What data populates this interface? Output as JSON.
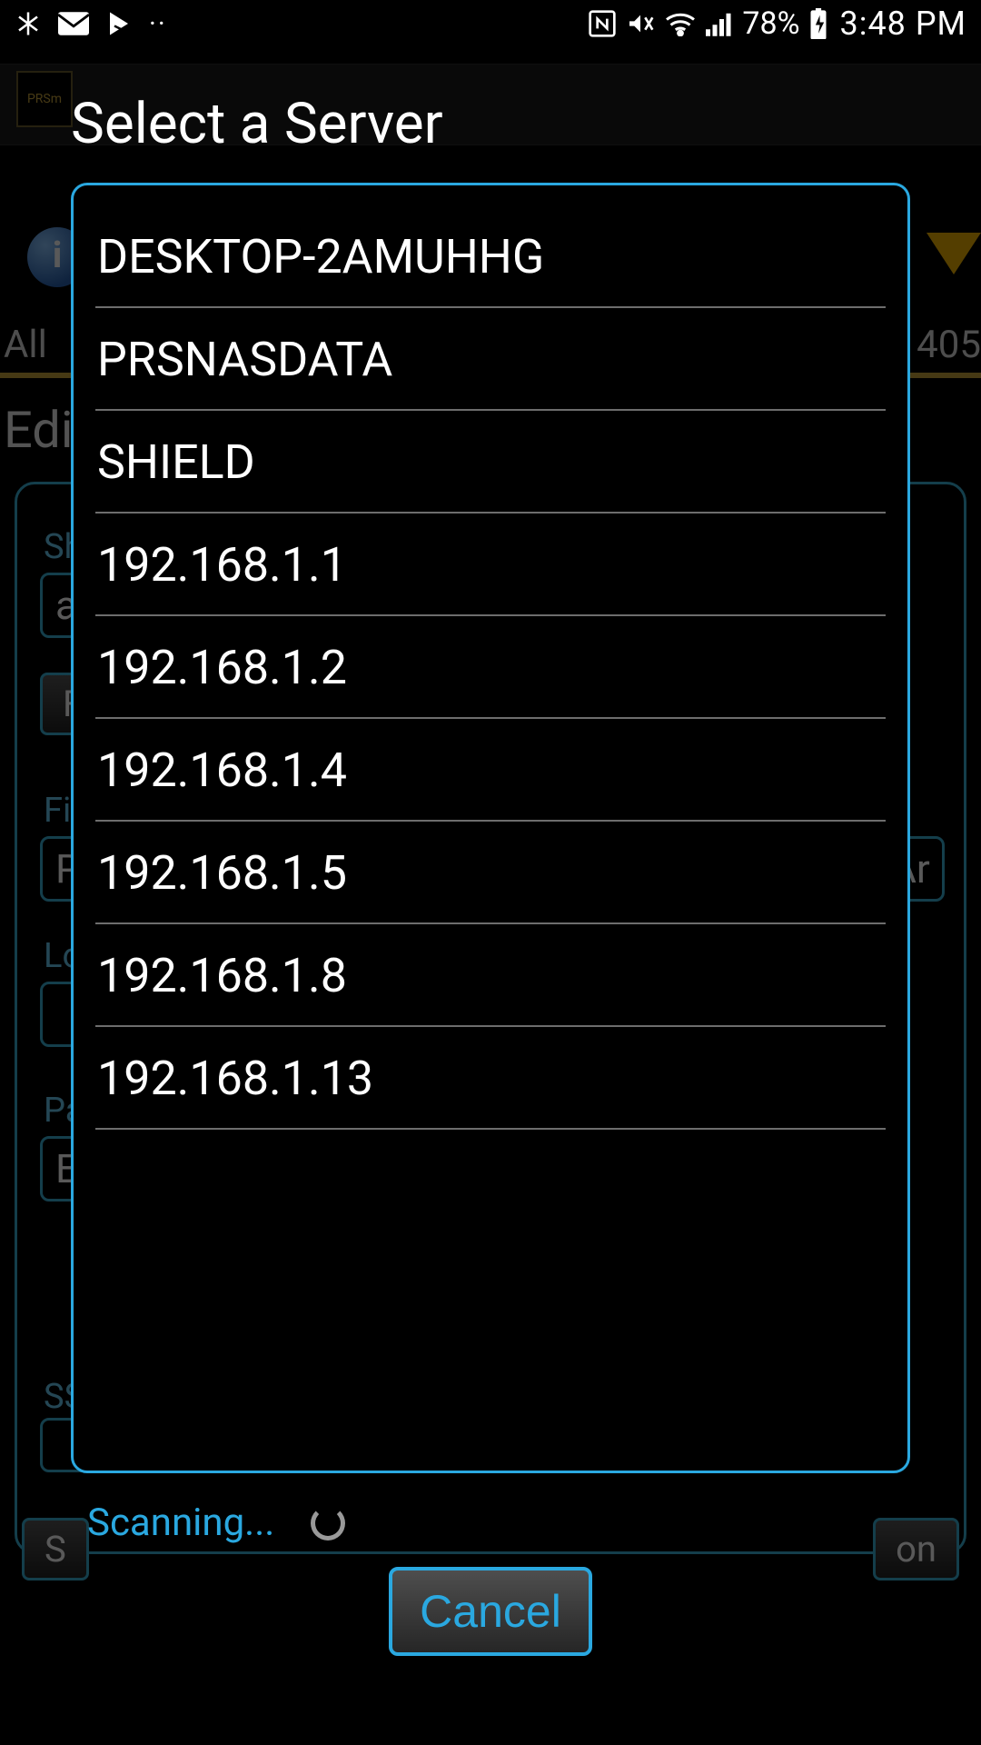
{
  "status_bar": {
    "battery_pct": "78%",
    "time": "3:48 PM"
  },
  "background": {
    "logo_text": "PRSm",
    "tab_left": "All",
    "tab_right": "405",
    "heading": "Edi",
    "labels": {
      "sh": "Sh",
      "fi": "Fi",
      "lo": "Lo",
      "pa": "Pa",
      "ss": "SS"
    },
    "input_a": "a",
    "btn_f": "F",
    "input_p": "P",
    "input_e": "E",
    "right_ar": "Ar",
    "btn_s": "S",
    "btn_on": "on"
  },
  "dialog": {
    "title": "Select a Server",
    "servers": [
      "DESKTOP-2AMUHHG",
      "PRSNASDATA",
      "SHIELD",
      "192.168.1.1",
      "192.168.1.2",
      "192.168.1.4",
      "192.168.1.5",
      "192.168.1.8",
      "192.168.1.13"
    ],
    "scanning_label": "Scanning...",
    "cancel_label": "Cancel"
  }
}
